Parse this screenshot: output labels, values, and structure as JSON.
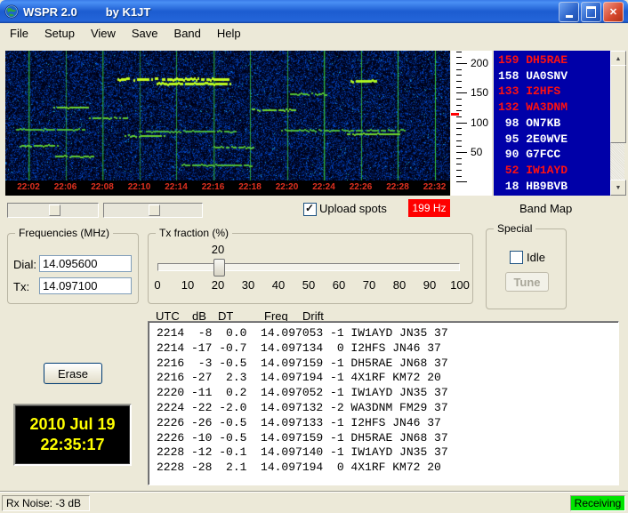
{
  "window": {
    "title": "WSPR 2.0",
    "byline": "by K1JT"
  },
  "menu": {
    "items": [
      "File",
      "Setup",
      "View",
      "Save",
      "Band",
      "Help"
    ]
  },
  "waterfall": {
    "timestamps": [
      "22:02",
      "22:06",
      "22:08",
      "22:10",
      "22:14",
      "22:16",
      "22:18",
      "22:20",
      "22:24",
      "22:26",
      "22:28",
      "22:32"
    ]
  },
  "freq_scale": {
    "labels": [
      200,
      150,
      100,
      50
    ],
    "marker_value": 114
  },
  "band_map": {
    "label": "Band Map",
    "entries": [
      {
        "num": "159",
        "call": "DH5RAE",
        "color": "red"
      },
      {
        "num": "158",
        "call": "UA0SNV",
        "color": "white"
      },
      {
        "num": "133",
        "call": "I2HFS",
        "color": "red"
      },
      {
        "num": "132",
        "call": "WA3DNM",
        "color": "red"
      },
      {
        "num": "98",
        "call": "ON7KB",
        "color": "white"
      },
      {
        "num": "95",
        "call": "2E0WVE",
        "color": "white"
      },
      {
        "num": "90",
        "call": "G7FCC",
        "color": "white"
      },
      {
        "num": "52",
        "call": "IW1AYD",
        "color": "red"
      },
      {
        "num": "18",
        "call": "HB9BVB",
        "color": "white"
      }
    ]
  },
  "controls": {
    "upload_spots": {
      "label": "Upload spots",
      "checked": true
    },
    "rx_offset": "199 Hz"
  },
  "frequencies": {
    "title": "Frequencies (MHz)",
    "dial": {
      "label": "Dial:",
      "value": "14.095600"
    },
    "tx": {
      "label": "Tx:",
      "value": "14.097100"
    }
  },
  "tx_fraction": {
    "title": "Tx fraction (%)",
    "value": "20",
    "percent": 20,
    "ticks": [
      0,
      10,
      20,
      30,
      40,
      50,
      60,
      70,
      80,
      90,
      100
    ]
  },
  "special": {
    "title": "Special",
    "idle_label": "Idle",
    "idle_checked": false,
    "tune_label": "Tune"
  },
  "decoder": {
    "headers": [
      "UTC",
      "dB",
      "DT",
      "Freq",
      "Drift"
    ],
    "erase_label": "Erase",
    "rows": [
      "2214  -8  0.0  14.097053 -1 IW1AYD JN35 37",
      "2214 -17 -0.7  14.097134  0 I2HFS JN46 37",
      "2216  -3 -0.5  14.097159 -1 DH5RAE JN68 37",
      "2216 -27  2.3  14.097194 -1 4X1RF KM72 20",
      "2220 -11  0.2  14.097052 -1 IW1AYD JN35 37",
      "2224 -22 -2.0  14.097132 -2 WA3DNM FM29 37",
      "2226 -26 -0.5  14.097133 -1 I2HFS JN46 37",
      "2226 -10 -0.5  14.097159 -1 DH5RAE JN68 37",
      "2228 -12 -0.1  14.097140 -1 IW1AYD JN35 37",
      "2228 -28  2.1  14.097194  0 4X1RF KM72 20"
    ]
  },
  "clock": {
    "date": "2010 Jul 19",
    "time": "22:35:17"
  },
  "status": {
    "rx_noise": "Rx Noise: -3 dB",
    "mode": "Receiving"
  },
  "colors": {
    "bandmap_bg": "#0000A8",
    "highlight": "#FF0000",
    "receiving_bg": "#00E400",
    "clock_text": "#FFFF00"
  }
}
